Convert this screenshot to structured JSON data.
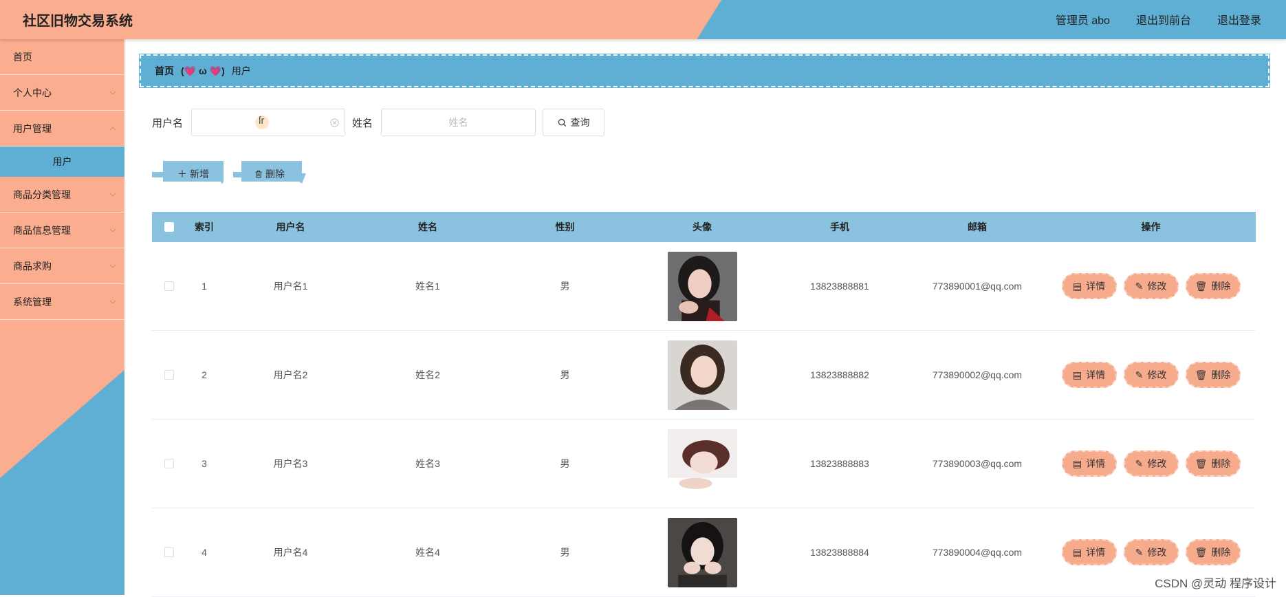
{
  "app": {
    "title": "社区旧物交易系统"
  },
  "header": {
    "admin_label": "管理员 abo",
    "front_label": "退出到前台",
    "logout_label": "退出登录"
  },
  "sidebar": {
    "items": [
      {
        "label": "首页"
      },
      {
        "label": "个人中心"
      },
      {
        "label": "用户管理"
      },
      {
        "label": "商品分类管理"
      },
      {
        "label": "商品信息管理"
      },
      {
        "label": "商品求购"
      },
      {
        "label": "系统管理"
      }
    ],
    "sub_active": "用户"
  },
  "breadcrumb": {
    "home": "首页",
    "separator": "(💗 ω 💗)",
    "current": "用户"
  },
  "search": {
    "username_label": "用户名",
    "username_cursor": "ſr",
    "name_label": "姓名",
    "name_placeholder": "姓名",
    "query_label": "查询"
  },
  "actions": {
    "add_label": "新增",
    "delete_label": "删除"
  },
  "table": {
    "headers": {
      "index": "索引",
      "username": "用户名",
      "name": "姓名",
      "sex": "性别",
      "avatar": "头像",
      "phone": "手机",
      "email": "邮箱",
      "ops": "操作"
    },
    "op_labels": {
      "detail": "详情",
      "edit": "修改",
      "delete": "删除"
    },
    "rows": [
      {
        "index": "1",
        "username": "用户名1",
        "name": "姓名1",
        "sex": "男",
        "phone": "13823888881",
        "email": "773890001@qq.com"
      },
      {
        "index": "2",
        "username": "用户名2",
        "name": "姓名2",
        "sex": "男",
        "phone": "13823888882",
        "email": "773890002@qq.com"
      },
      {
        "index": "3",
        "username": "用户名3",
        "name": "姓名3",
        "sex": "男",
        "phone": "13823888883",
        "email": "773890003@qq.com"
      },
      {
        "index": "4",
        "username": "用户名4",
        "name": "姓名4",
        "sex": "男",
        "phone": "13823888884",
        "email": "773890004@qq.com"
      }
    ]
  },
  "watermark": "CSDN @灵动 程序设计",
  "colors": {
    "peach": "#fbad8f",
    "blue": "#5faed4",
    "table_head": "#8ac2df",
    "op_button": "#f7ab8d"
  }
}
